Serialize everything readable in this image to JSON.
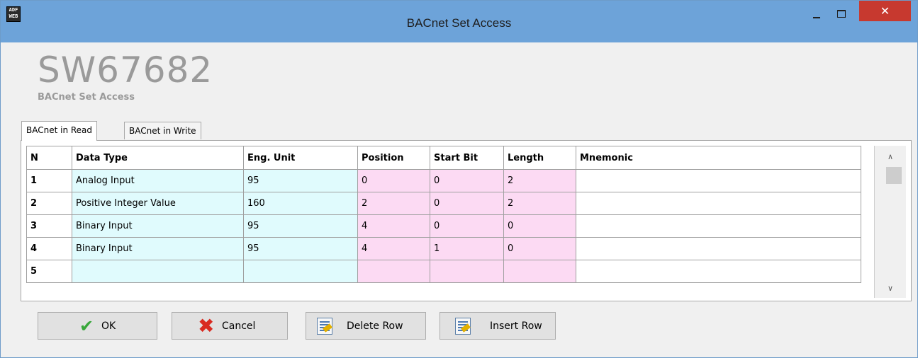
{
  "window": {
    "app_icon_text": "ADF WEB",
    "title": "BACnet Set Access",
    "close_glyph": "✕"
  },
  "header": {
    "logo": "SW67682",
    "subtitle": "BACnet Set Access"
  },
  "tabs": [
    {
      "label": "BACnet in Read",
      "active": true
    },
    {
      "label": "BACnet in Write",
      "active": false
    }
  ],
  "grid": {
    "columns": [
      "N",
      "Data Type",
      "Eng. Unit",
      "Position",
      "Start Bit",
      "Length",
      "Mnemonic"
    ],
    "rows": [
      {
        "n": "1",
        "data_type": "Analog Input",
        "eng_unit": "95",
        "position": "0",
        "start_bit": "0",
        "length": "2",
        "mnemonic": ""
      },
      {
        "n": "2",
        "data_type": "Positive Integer Value",
        "eng_unit": "160",
        "position": "2",
        "start_bit": "0",
        "length": "2",
        "mnemonic": ""
      },
      {
        "n": "3",
        "data_type": "Binary Input",
        "eng_unit": "95",
        "position": "4",
        "start_bit": "0",
        "length": "0",
        "mnemonic": ""
      },
      {
        "n": "4",
        "data_type": "Binary Input",
        "eng_unit": "95",
        "position": "4",
        "start_bit": "1",
        "length": "0",
        "mnemonic": ""
      },
      {
        "n": "5",
        "data_type": "",
        "eng_unit": "",
        "position": "",
        "start_bit": "",
        "length": "",
        "mnemonic": ""
      }
    ],
    "scroll_up_glyph": "∧",
    "scroll_down_glyph": "∨"
  },
  "buttons": {
    "ok": "OK",
    "cancel": "Cancel",
    "delete_row": "Delete Row",
    "insert_row": "Insert Row"
  },
  "icons": {
    "ok": "check-icon",
    "cancel": "x-icon",
    "delete_row": "document-edit-icon",
    "insert_row": "document-edit-icon"
  },
  "colors": {
    "titlebar": "#6da3d9",
    "close_button": "#c7392f",
    "cyan_cells": "#e0fbfd",
    "pink_cells": "#fcdaf3"
  }
}
